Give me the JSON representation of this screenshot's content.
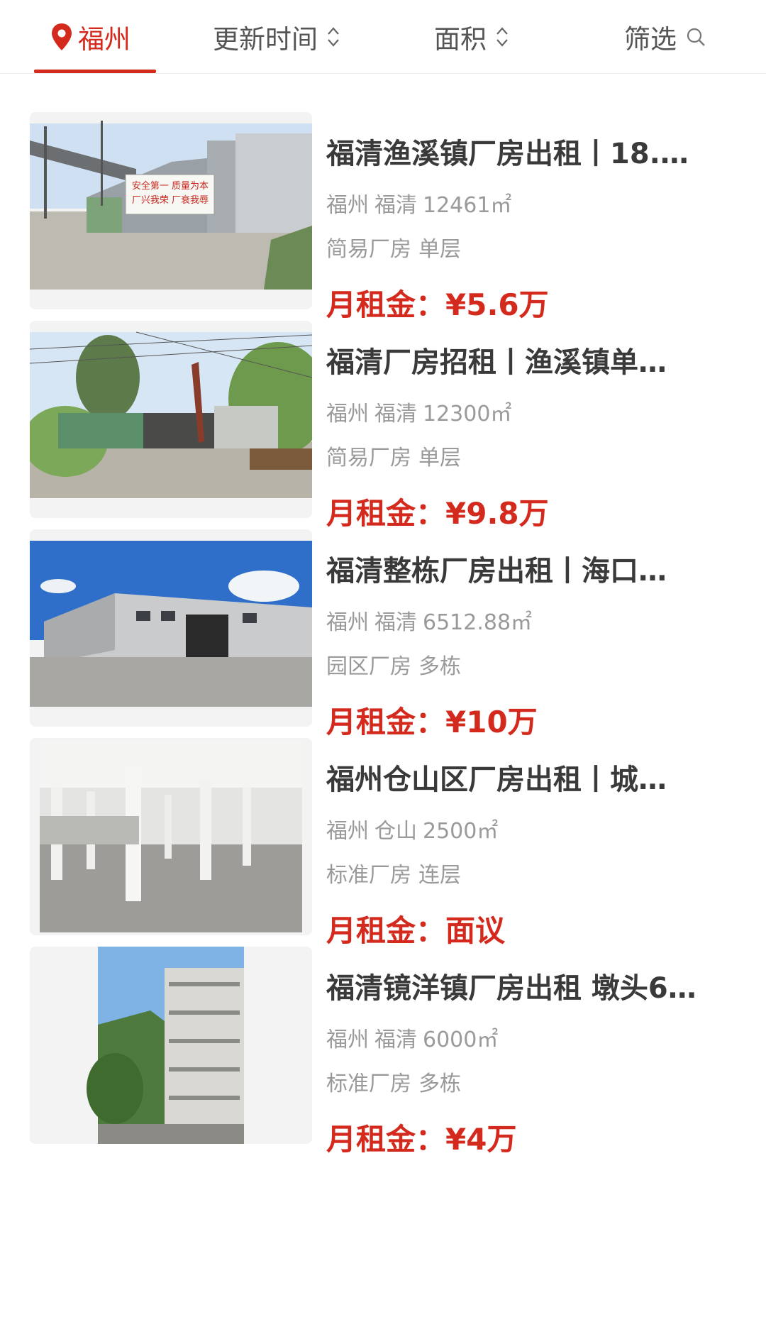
{
  "filter_bar": {
    "city": "福州",
    "sort_time": "更新时间",
    "sort_area": "面积",
    "filter": "筛选",
    "accent_color": "#d42a1e"
  },
  "listings": [
    {
      "title": "福清渔溪镇厂房出租丨18.…",
      "city": "福州",
      "district": "福清",
      "area": "12461㎡",
      "type": "简易厂房",
      "floors": "单层",
      "price_label": "月租金：",
      "price": "¥5.6万",
      "image": "factory-yard-banner-photo",
      "banner_text": [
        "安全第一 质量为本",
        "厂兴我荣 厂衰我辱"
      ]
    },
    {
      "title": "福清厂房招租丨渔溪镇单…",
      "city": "福州",
      "district": "福清",
      "area": "12300㎡",
      "type": "简易厂房",
      "floors": "单层",
      "price_label": "月租金：",
      "price": "¥9.8万",
      "image": "factory-gate-trees-photo"
    },
    {
      "title": "福清整栋厂房出租丨海口…",
      "city": "福州",
      "district": "福清",
      "area": "6512.88㎡",
      "type": "园区厂房",
      "floors": "多栋",
      "price_label": "月租金：",
      "price": "¥10万",
      "image": "warehouse-blue-sky-photo"
    },
    {
      "title": "福州仓山区厂房出租丨城…",
      "city": "福州",
      "district": "仓山",
      "area": "2500㎡",
      "type": "标准厂房",
      "floors": "连层",
      "price_label": "月租金：",
      "price": "面议",
      "image": "empty-interior-columns-photo"
    },
    {
      "title": "福清镜洋镇厂房出租 墩头6…",
      "city": "福州",
      "district": "福清",
      "area": "6000㎡",
      "type": "标准厂房",
      "floors": "多栋",
      "price_label": "月租金：",
      "price": "¥4万",
      "image": "multistory-building-photo"
    }
  ]
}
